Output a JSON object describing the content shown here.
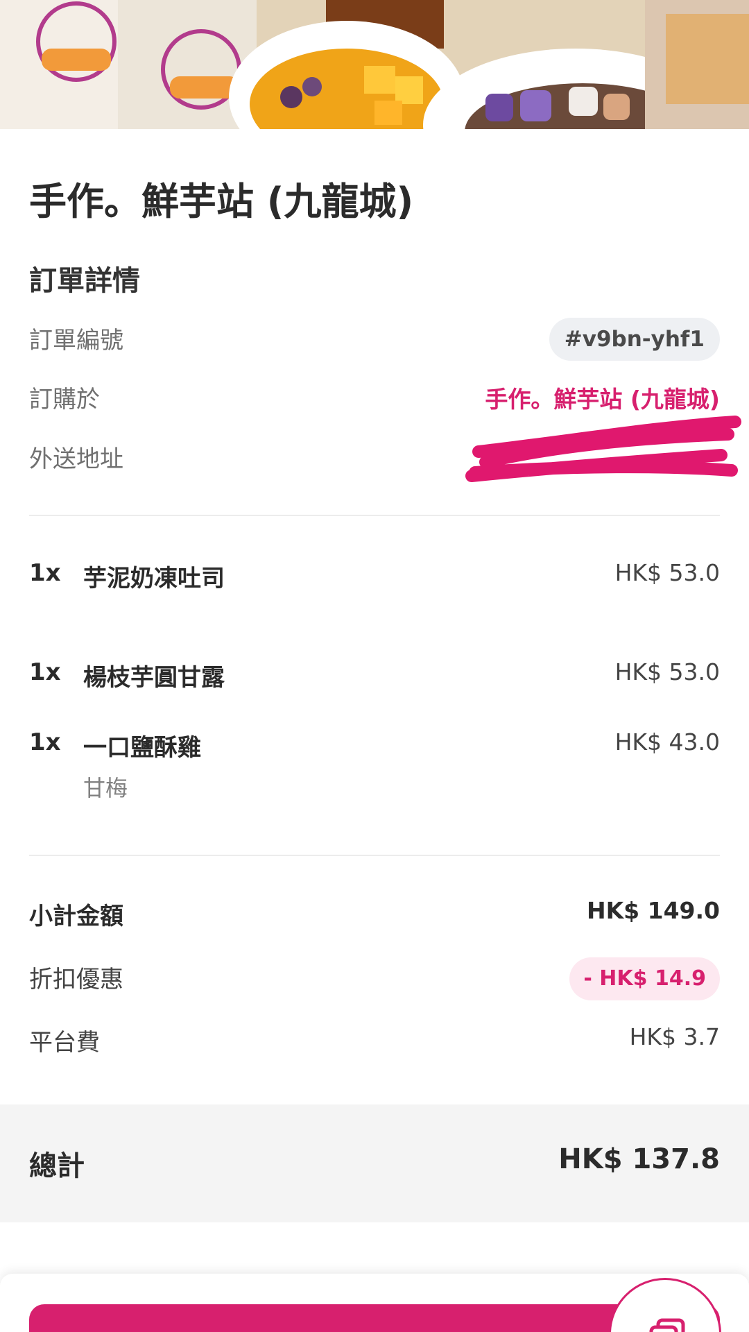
{
  "header": {
    "shop_name": "手作。鮮芋站 (九龍城)"
  },
  "details": {
    "section_title": "訂單詳情",
    "order_number_label": "訂單編號",
    "order_number": "#v9bn-yhf1",
    "ordered_from_label": "訂購於",
    "ordered_from": "手作。鮮芋站 (九龍城)",
    "delivery_address_label": "外送地址"
  },
  "items": [
    {
      "qty": "1x",
      "name": "芋泥奶凍吐司",
      "price": "HK$ 53.0"
    },
    {
      "qty": "1x",
      "name": "楊枝芋圓甘露",
      "price": "HK$ 53.0"
    },
    {
      "qty": "1x",
      "name": "一口鹽酥雞",
      "price": "HK$ 43.0",
      "option": "甘梅"
    }
  ],
  "summary": {
    "subtotal_label": "小計金額",
    "subtotal": "HK$ 149.0",
    "discount_label": "折扣優惠",
    "discount": "- HK$ 14.9",
    "platform_fee_label": "平台費",
    "platform_fee": "HK$ 3.7",
    "total_label": "總計",
    "total": "HK$ 137.8"
  },
  "colors": {
    "accent": "#d7206e",
    "accent_soft": "#fde8f0",
    "pill_gray": "#eef0f3"
  },
  "icons": {
    "fab": "copy-icon"
  }
}
